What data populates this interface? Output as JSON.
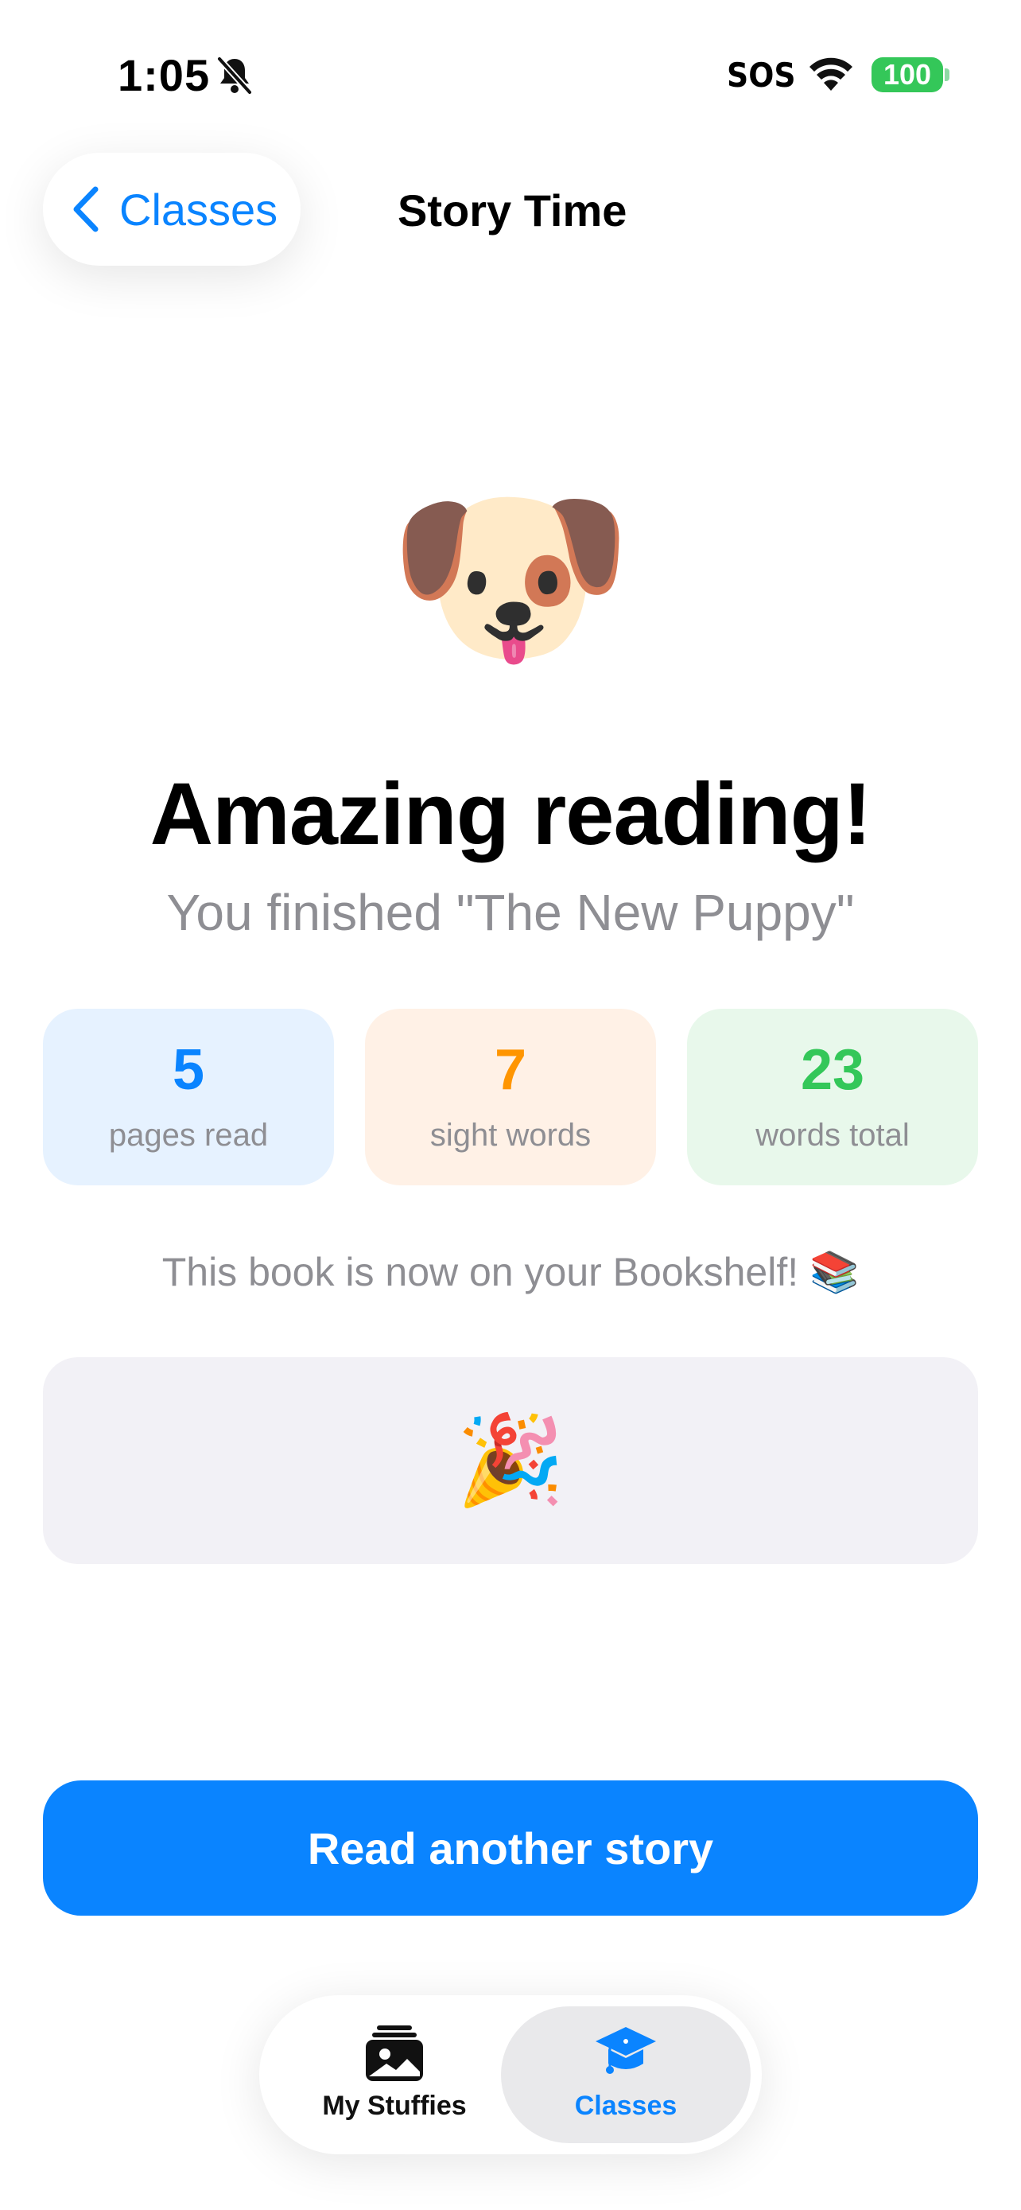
{
  "status_bar": {
    "time": "1:05",
    "carrier": "SOS",
    "battery": "100",
    "icons": [
      "bell-slash-icon",
      "wifi-icon",
      "battery-icon"
    ]
  },
  "nav": {
    "back_label": "Classes",
    "title": "Story Time"
  },
  "hero": {
    "emoji": "🐶",
    "headline": "Amazing reading!",
    "subheadline": "You finished \"The New Puppy\""
  },
  "stats": [
    {
      "value": "5",
      "label": "pages read",
      "color": "#0a84ff"
    },
    {
      "value": "7",
      "label": "sight words",
      "color": "#ff9500"
    },
    {
      "value": "23",
      "label": "words total",
      "color": "#34c759"
    }
  ],
  "bookshelf_note": "This book is now on your Bookshelf! 📚",
  "celebration_emoji": "🎉",
  "primary_button": "Read another story",
  "tabs": [
    {
      "label": "My Stuffies",
      "icon": "photo-stack-icon",
      "selected": false
    },
    {
      "label": "Classes",
      "icon": "graduation-cap-icon",
      "selected": true
    }
  ],
  "colors": {
    "accent": "#0a84ff",
    "battery": "#34c759",
    "secondary_text": "#8e8e93"
  }
}
